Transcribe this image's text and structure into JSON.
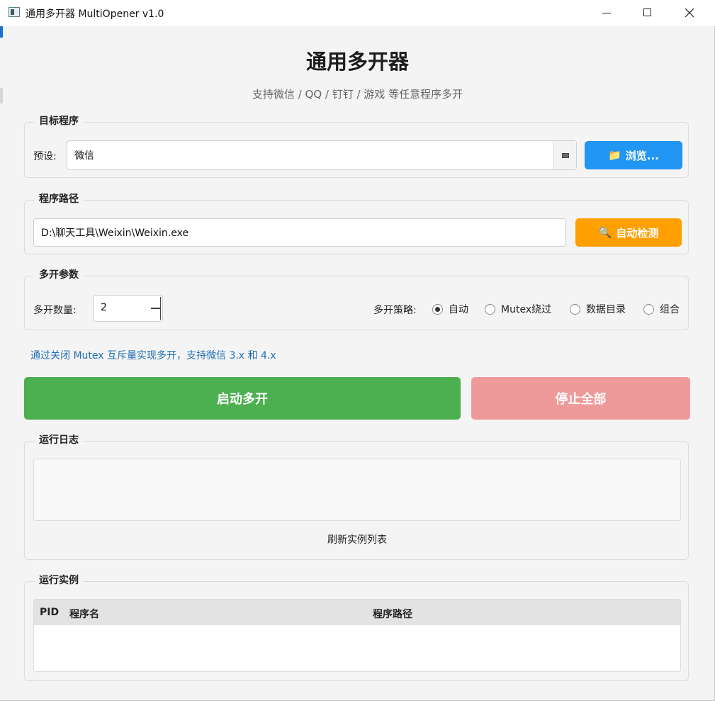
{
  "window": {
    "title": "通用多开器 MultiOpener v1.0"
  },
  "header": {
    "title": "通用多开器",
    "subtitle": "支持微信 / QQ / 钉钉 / 游戏 等任意程序多开"
  },
  "target": {
    "group_title": "目标程序",
    "preset_label": "预设:",
    "preset_value": "微信",
    "browse_label": "浏览...",
    "browse_icon": "folder-icon"
  },
  "path": {
    "group_title": "程序路径",
    "value": "D:\\聊天工具\\Weixin\\Weixin.exe",
    "detect_label": "自动检测",
    "detect_icon": "magnifier-icon"
  },
  "params": {
    "group_title": "多开参数",
    "count_label": "多开数量:",
    "count_value": "2",
    "strategy_label": "多开策略:",
    "strategies": [
      "自动",
      "Mutex绕过",
      "数据目录",
      "组合"
    ],
    "selected_strategy": "自动"
  },
  "hint": "通过关闭 Mutex 互斥量实现多开，支持微信 3.x 和 4.x",
  "actions": {
    "start_label": "启动多开",
    "stop_label": "停止全部"
  },
  "log": {
    "group_title": "运行日志",
    "refresh_label": "刷新实例列表"
  },
  "instances": {
    "group_title": "运行实例",
    "columns": [
      "PID",
      "程序名",
      "程序路径"
    ]
  },
  "colors": {
    "browse": "#2196f3",
    "detect": "#ff9f00",
    "start": "#4caf50",
    "stop": "#ef9a9a",
    "hint": "#1f6fb3"
  }
}
